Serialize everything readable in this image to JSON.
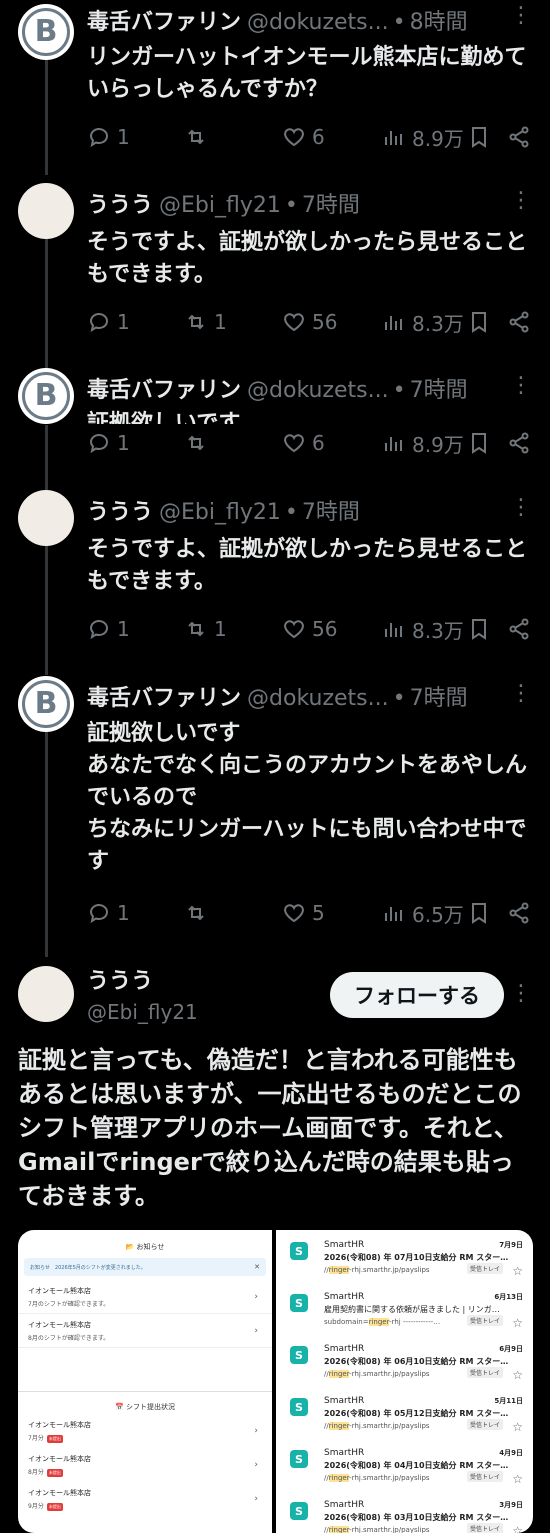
{
  "users": {
    "doku": {
      "name": "毒舌バファリン",
      "handle": "@dokuzets...",
      "avatar_letter": "B"
    },
    "uuu": {
      "name": "ううう",
      "handle": "@Ebi_fly21"
    }
  },
  "tweets": [
    {
      "time": "8時間",
      "text": "リンガーハットイオンモール熊本店に勤めていらっしゃるんですか？",
      "replies": "1",
      "retweets": "",
      "likes": "6",
      "views": "8.9万"
    },
    {
      "time": "7時間",
      "text": "そうですよ、証拠が欲しかったら見せることもできます。",
      "replies": "1",
      "retweets": "1",
      "likes": "56",
      "views": "8.3万"
    },
    {
      "time": "7時間",
      "text": "証拠欲しいです",
      "replies": "1",
      "retweets": "",
      "likes": "6",
      "views": "8.9万"
    },
    {
      "time": "7時間",
      "text": "そうですよ、証拠が欲しかったら見せることもできます。",
      "replies": "1",
      "retweets": "1",
      "likes": "56",
      "views": "8.3万"
    },
    {
      "time": "7時間",
      "text": "証拠欲しいです\nあなたでなく向こうのアカウントをあやしんでいるので\nちなみにリンガーハットにも問い合わせ中です",
      "replies": "1",
      "retweets": "",
      "likes": "5",
      "views": "6.5万"
    }
  ],
  "main": {
    "follow_label": "フォローする",
    "text": "証拠と言っても、偽造だ！と言われる可能性もあるとは思いますが、一応出せるものだとこのシフト管理アプリのホーム画面です。それと、Gmailでringerで絞り込んだ時の結果も貼っておきます。"
  },
  "app_screen": {
    "title": "📂 お知らせ",
    "notice": "お知らせ　2026年5月のシフトが変更されました。",
    "notices": [
      {
        "store": "イオンモール熊本店",
        "msg": "7月のシフトが確認できます。"
      },
      {
        "store": "イオンモール熊本店",
        "msg": "8月のシフトが確認できます。"
      }
    ],
    "section_title": "📅 シフト提出状況",
    "submissions": [
      {
        "store": "イオンモール熊本店",
        "month": "7月分",
        "status": "未提出"
      },
      {
        "store": "イオンモール熊本店",
        "month": "8月分",
        "status": "未提出"
      },
      {
        "store": "イオンモール熊本店",
        "month": "9月分",
        "status": "未提出"
      }
    ]
  },
  "gmail": [
    {
      "from": "SmartHR",
      "date": "7月9日",
      "subject": "2026(令和08) 年 07月10日支給分 RM スター…",
      "snip_pre": "//",
      "snip_hl": "ringer",
      "snip_post": "-rhj.smarthr.jp/payslips",
      "label": "受信トレイ",
      "bold": true
    },
    {
      "from": "SmartHR",
      "date": "6月13日",
      "subject": "雇用契約書に関する依頼が届きました | リンガ…",
      "snip_pre": "subdomain=",
      "snip_hl": "ringer",
      "snip_post": "-rhj ------------…",
      "label": "受信トレイ",
      "bold": false
    },
    {
      "from": "SmartHR",
      "date": "6月9日",
      "subject": "2026(令和08) 年 06月10日支給分 RM スター…",
      "snip_pre": "//",
      "snip_hl": "ringer",
      "snip_post": "-rhj.smarthr.jp/payslips",
      "label": "受信トレイ",
      "bold": true
    },
    {
      "from": "SmartHR",
      "date": "5月11日",
      "subject": "2026(令和08) 年 05月12日支給分 RM スター…",
      "snip_pre": "//",
      "snip_hl": "ringer",
      "snip_post": "-rhj.smarthr.jp/payslips",
      "label": "受信トレイ",
      "bold": true
    },
    {
      "from": "SmartHR",
      "date": "4月9日",
      "subject": "2026(令和08) 年 04月10日支給分 RM スター…",
      "snip_pre": "//",
      "snip_hl": "ringer",
      "snip_post": "-rhj.smarthr.jp/payslips",
      "label": "受信トレイ",
      "bold": true
    },
    {
      "from": "SmartHR",
      "date": "3月9日",
      "subject": "2026(令和08) 年 03月10日支給分 RM スター…",
      "snip_pre": "//",
      "snip_hl": "ringer",
      "snip_post": "-rhj.smarthr.jp/payslips",
      "label": "受信トレイ",
      "bold": true
    }
  ],
  "icons": {
    "more": "more-icon",
    "reply": "reply-icon",
    "retweet": "retweet-icon",
    "like": "heart-icon",
    "views": "views-icon",
    "bookmark": "bookmark-icon",
    "share": "share-icon"
  },
  "colors": {
    "background": "#000000",
    "text": "#e7e9ea",
    "muted": "#71767b",
    "follow_bg": "#eff3f4",
    "smarthr": "#17b3a8",
    "highlight": "#fde293"
  }
}
